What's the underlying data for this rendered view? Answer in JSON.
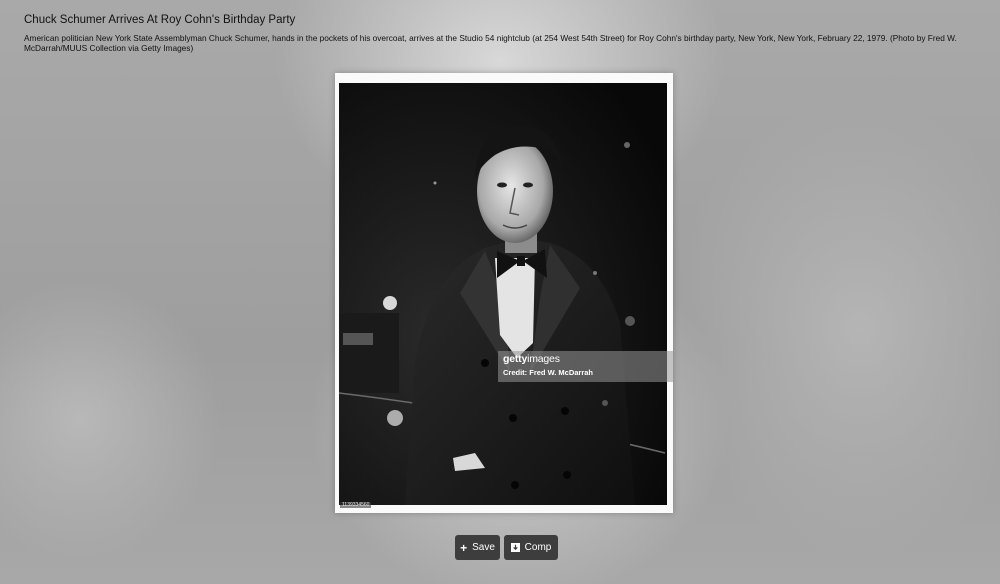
{
  "header": {
    "title": "Chuck Schumer Arrives At Roy Cohn's Birthday Party",
    "caption": "American politician New York State Assemblyman Chuck Schumer, hands in the pockets of his overcoat, arrives at the Studio 54 nightclub (at 254 West 54th Street) for Roy Cohn's birthday party, New York, New York, February 22, 1979. (Photo by Fred W. McDarrah/MUUS Collection via Getty Images)"
  },
  "photo": {
    "watermark_logo_bold": "getty",
    "watermark_logo_light": "images",
    "watermark_credit": "Credit: Fred W. McDarrah",
    "asset_id": "1139334560"
  },
  "actions": {
    "save_icon": "+",
    "save_label": "Save",
    "comp_icon": "download-icon",
    "comp_label": "Comp"
  }
}
